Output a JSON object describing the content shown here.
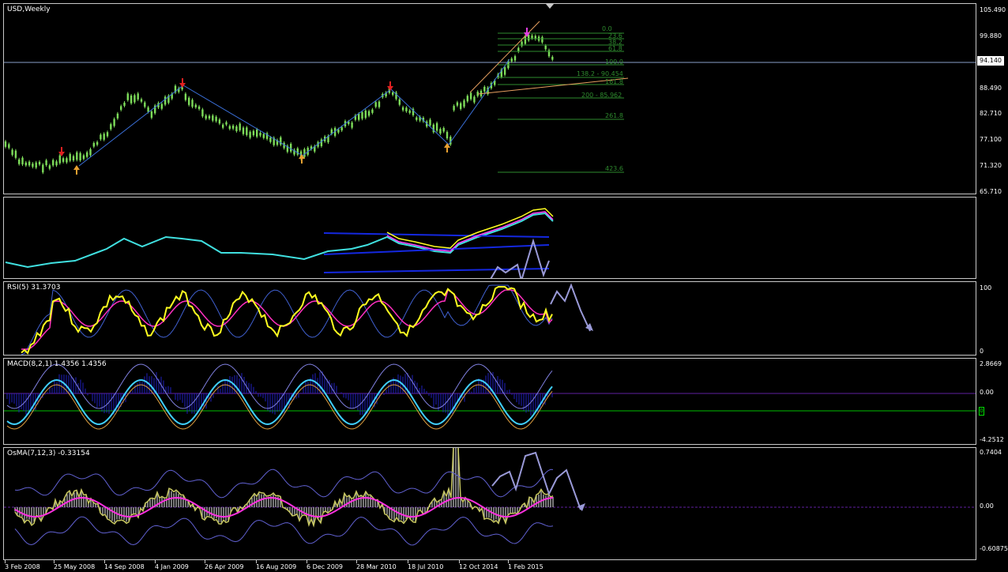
{
  "panes": {
    "main": {
      "label": "USD,Weekly"
    },
    "index": {
      "label": ""
    },
    "rsi": {
      "label": "RSI(5) 31.3703"
    },
    "macd": {
      "label": "MACD(8,2,1) 1.4356 1.4356"
    },
    "osma": {
      "label": "OsMA(7,12,3) -0.33154"
    }
  },
  "price_axis": [
    "105.490",
    "99.880",
    "94.140",
    "88.490",
    "82.710",
    "77.100",
    "71.320",
    "65.710"
  ],
  "current_price": "94.140",
  "fib_levels": [
    "0.0",
    "23.6",
    "38.2",
    "61.8",
    "100.0",
    "138.2 - 90.454",
    "161.8",
    "200 - 85.962",
    "261.8",
    "423.6"
  ],
  "rsi_axis": [
    "100",
    "0"
  ],
  "macd_axis": [
    "2.8669",
    "0.00",
    "-4.2512"
  ],
  "macd_marker": "0",
  "osma_axis": [
    "0.7404",
    "0.00",
    "-0.60875"
  ],
  "dates": [
    "3 Feb 2008",
    "25 May 2008",
    "14 Sep 2008",
    "4 Jan 2009",
    "26 Apr 2009",
    "16 Aug 2009",
    "6 Dec 2009",
    "28 Mar 2010",
    "18 Jul 2010",
    "12 Oct 2014",
    "1 Feb 2015"
  ],
  "colors": {
    "background": "#000000",
    "grid_border": "#c8c8c8",
    "candle": "#7ddc5a",
    "trend_line": "#3a6fd8",
    "fib": "#2e8b2e",
    "down_arrow": "#e02020",
    "up_arrow": "#e8a030",
    "rsi_main": "#ffff20",
    "rsi_signal": "#ff30c0",
    "index_line": "#40e0e0",
    "band": "#1428e0",
    "forecast": "#9a9ad8",
    "macd_hist": "#2020c0",
    "osma_hist": "#a0a0a0",
    "osma_line": "#ff30e0"
  }
}
